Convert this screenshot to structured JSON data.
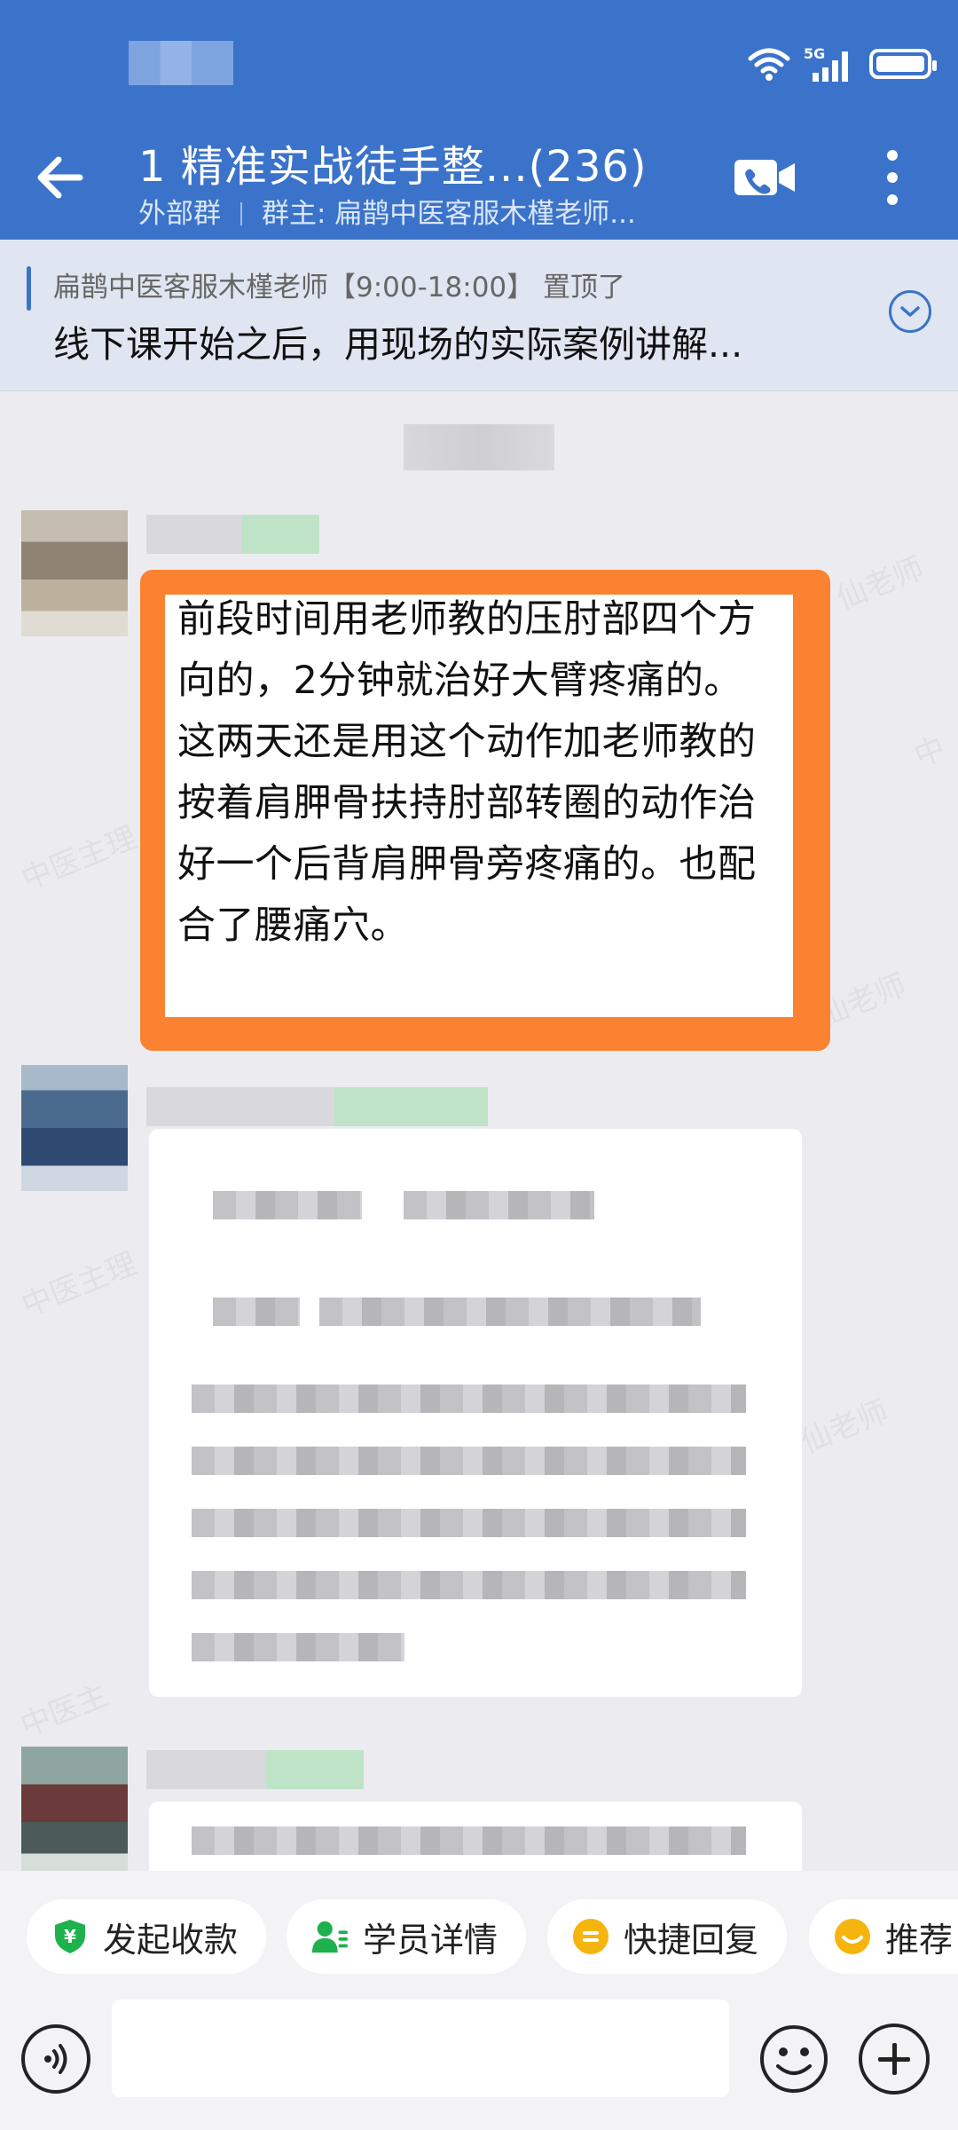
{
  "header": {
    "title": "1  精准实战徒手整...(236)",
    "tag": "外部群",
    "owner": "群主: 扁鹊中医客服木槿老师..."
  },
  "status_bar": {
    "network": "5G"
  },
  "pinned": {
    "meta": "扁鹊中医客服木槿老师【9:00-18:00】 置顶了",
    "text": "线下课开始之后，用现场的实际案例讲解..."
  },
  "messages": [
    {
      "text": "前段时间用老师教的压肘部四个方向的，2分钟就治好大臂疼痛的。这两天还是用这个动作加老师教的按着肩胛骨扶持肘部转圈的动作治好一个后背肩胛骨旁疼痛的。也配合了腰痛穴。"
    }
  ],
  "quick_actions": [
    {
      "label": "发起收款",
      "icon": "payment-icon",
      "color": "#1fb14d"
    },
    {
      "label": "学员详情",
      "icon": "user-detail-icon",
      "color": "#1fb14d"
    },
    {
      "label": "快捷回复",
      "icon": "quick-reply-icon",
      "color": "#f6b40e"
    },
    {
      "label": "推荐",
      "icon": "recommend-icon",
      "color": "#f6b40e"
    }
  ],
  "colors": {
    "header": "#3a73c9",
    "highlight": "#fa8230"
  }
}
